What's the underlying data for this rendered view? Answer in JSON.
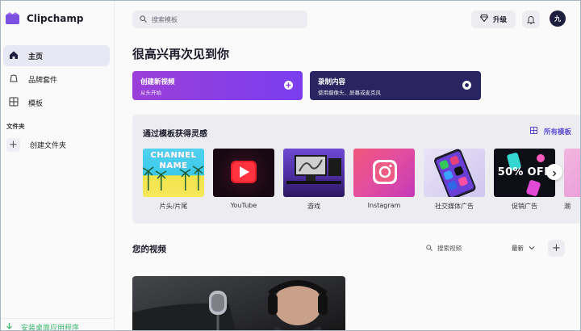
{
  "app": {
    "name": "Clipchamp"
  },
  "sidebar": {
    "items": [
      {
        "label": "主页",
        "icon": "home-icon",
        "active": true
      },
      {
        "label": "品牌套件",
        "icon": "brand-kit-icon",
        "active": false
      },
      {
        "label": "模板",
        "icon": "templates-icon",
        "active": false
      }
    ],
    "folders_label": "文件夹",
    "create_folder_label": "创建文件夹",
    "desktop_app_label": "安装桌面应用程序"
  },
  "topbar": {
    "search_placeholder": "搜索模板",
    "upgrade_label": "升级",
    "avatar_initial": "九"
  },
  "greeting": "很高兴再次见到你",
  "actions": {
    "create": {
      "title": "创建新视频",
      "subtitle": "从头开始"
    },
    "record": {
      "title": "录制内容",
      "subtitle": "使用摄像头、屏幕或麦克风"
    }
  },
  "templates": {
    "title": "通过模板获得灵感",
    "all_label": "所有模板",
    "items": [
      {
        "label": "片头/片尾",
        "thumb_text": "CHANNEL NAME"
      },
      {
        "label": "YouTube"
      },
      {
        "label": "游戏"
      },
      {
        "label": "Instagram"
      },
      {
        "label": "社交媒体广告"
      },
      {
        "label": "促销广告",
        "thumb_text": "50% OFF"
      },
      {
        "label": "潮"
      }
    ]
  },
  "videos": {
    "title": "您的视频",
    "search_placeholder": "搜索视频",
    "sort_label": "最新"
  },
  "colors": {
    "accent": "#5b4bd6",
    "create_gradient_start": "#9b3fd8",
    "create_gradient_end": "#7a3ef0",
    "record_bg": "#2a2460",
    "desktop_link": "#3ab56c"
  }
}
